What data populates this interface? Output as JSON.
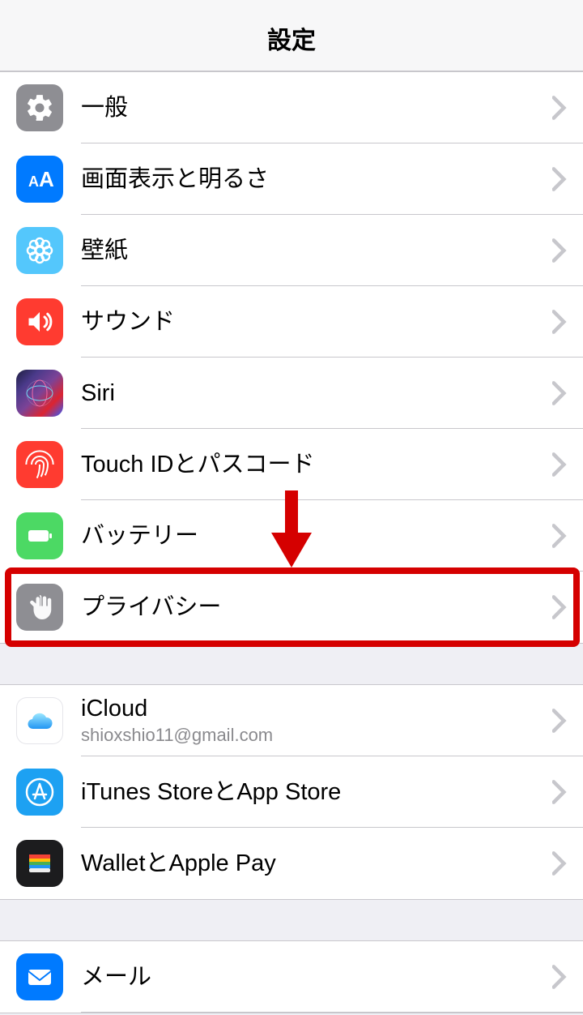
{
  "header": {
    "title": "設定"
  },
  "sections": [
    {
      "items": [
        {
          "label": "一般"
        },
        {
          "label": "画面表示と明るさ"
        },
        {
          "label": "壁紙"
        },
        {
          "label": "サウンド"
        },
        {
          "label": "Siri"
        },
        {
          "label": "Touch IDとパスコード"
        },
        {
          "label": "バッテリー"
        },
        {
          "label": "プライバシー"
        }
      ]
    },
    {
      "items": [
        {
          "label": "iCloud",
          "sublabel": "shioxshio11@gmail.com"
        },
        {
          "label": "iTunes StoreとApp Store"
        },
        {
          "label": "WalletとApple Pay"
        }
      ]
    },
    {
      "items": [
        {
          "label": "メール"
        }
      ]
    }
  ]
}
